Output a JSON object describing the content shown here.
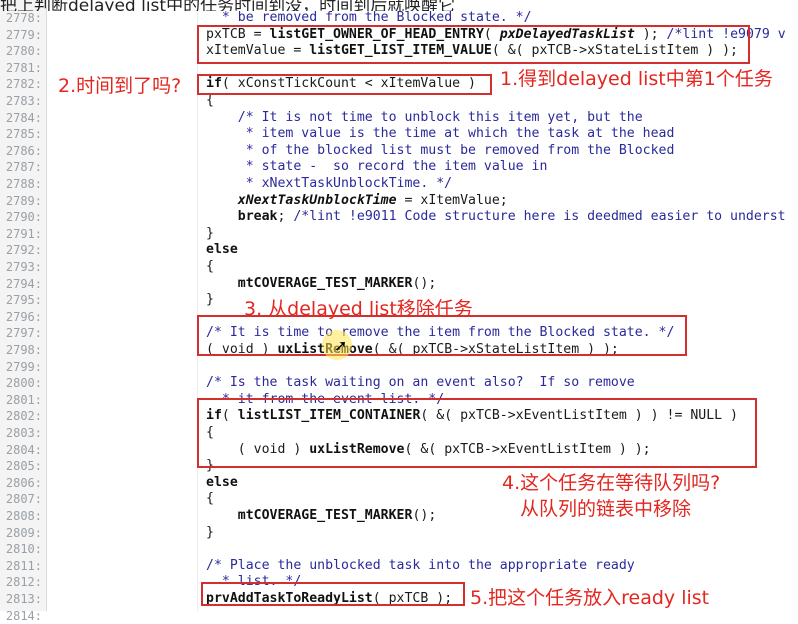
{
  "header": {
    "top_text": "把上判断delayed list中的任务时间到没，时间到后就唤醒它"
  },
  "lines": [
    {
      "num": "2778:",
      "html": "  <span class=\"cm\">* be removed from the Blocked state. */</span>"
    },
    {
      "num": "2779:",
      "html": "pxTCB = <span class=\"kw\">listGET_OWNER_OF_HEAD_ENTRY</span>( <span class=\"kw\"><i>pxDelayedTaskList</i></span> ); <span class=\"cm\">/*lint !e9079 v</span>"
    },
    {
      "num": "2780:",
      "html": "xItemValue = <span class=\"kw\">listGET_LIST_ITEM_VALUE</span>( &amp;( pxTCB-&gt;xStateListItem ) );"
    },
    {
      "num": "2781:",
      "html": ""
    },
    {
      "num": "2782:",
      "html": "<span class=\"kw\">if</span>( xConstTickCount &lt; xItemValue )"
    },
    {
      "num": "2783:",
      "html": "{"
    },
    {
      "num": "2784:",
      "html": "    <span class=\"cm\">/* It is not time to unblock this item yet, but the</span>"
    },
    {
      "num": "2785:",
      "html": "<span class=\"cm\">     * item value is the time at which the task at the head</span>"
    },
    {
      "num": "2786:",
      "html": "<span class=\"cm\">     * of the blocked list must be removed from the Blocked</span>"
    },
    {
      "num": "2787:",
      "html": "<span class=\"cm\">     * state -  so record the item value in</span>"
    },
    {
      "num": "2788:",
      "html": "<span class=\"cm\">     * xNextTaskUnblockTime. */</span>"
    },
    {
      "num": "2789:",
      "html": "    <span class=\"kw\"><i>xNextTaskUnblockTime</i></span> = xItemValue;"
    },
    {
      "num": "2790:",
      "html": "    <span class=\"kw\">break</span>; <span class=\"cm\">/*lint !e9011 Code structure here is deedmed easier to underst</span>"
    },
    {
      "num": "2791:",
      "html": "}"
    },
    {
      "num": "2792:",
      "html": "<span class=\"kw\">else</span>"
    },
    {
      "num": "2793:",
      "html": "{"
    },
    {
      "num": "2794:",
      "html": "    <span class=\"kw\">mtCOVERAGE_TEST_MARKER</span>();"
    },
    {
      "num": "2795:",
      "html": "}"
    },
    {
      "num": "2796:",
      "html": ""
    },
    {
      "num": "2797:",
      "html": "<span class=\"cm\">/* It is time to remove the item from the Blocked state. */</span>"
    },
    {
      "num": "2798:",
      "html": "( void ) <span class=\"kw\">uxListRemove</span>( &amp;( pxTCB-&gt;xStateListItem ) );"
    },
    {
      "num": "2799:",
      "html": ""
    },
    {
      "num": "2800:",
      "html": "<span class=\"cm\">/* Is the task waiting on an event also?  If so remove</span>"
    },
    {
      "num": "2801:",
      "html": "<span class=\"cm\">  * it from the event list. */</span>"
    },
    {
      "num": "2802:",
      "html": "<span class=\"kw\">if</span>( <span class=\"kw\">listLIST_ITEM_CONTAINER</span>( &amp;( pxTCB-&gt;xEventListItem ) ) != NULL )"
    },
    {
      "num": "2803:",
      "html": "{"
    },
    {
      "num": "2804:",
      "html": "    ( void ) <span class=\"kw\">uxListRemove</span>( &amp;( pxTCB-&gt;xEventListItem ) );"
    },
    {
      "num": "2805:",
      "html": "}"
    },
    {
      "num": "2806:",
      "html": "<span class=\"kw\">else</span>"
    },
    {
      "num": "2807:",
      "html": "{"
    },
    {
      "num": "2808:",
      "html": "    <span class=\"kw\">mtCOVERAGE_TEST_MARKER</span>();"
    },
    {
      "num": "2809:",
      "html": "}"
    },
    {
      "num": "2810:",
      "html": ""
    },
    {
      "num": "2811:",
      "html": "<span class=\"cm\">/* Place the unblocked task into the appropriate ready</span>"
    },
    {
      "num": "2812:",
      "html": "<span class=\"cm\">  * list. */</span>"
    },
    {
      "num": "2813:",
      "html": "<span class=\"kw\">prvAddTaskToReadyList</span>( pxTCB );"
    },
    {
      "num": "2814:",
      "html": ""
    }
  ],
  "annotations": {
    "a1": "1.得到delayed list中第1个任务",
    "a2": "2.时间到了吗?",
    "a3": "3. 从delayed list移除任务",
    "a4_line1": "4.这个任务在等待队列吗?",
    "a4_line2": "从队列的链表中移除",
    "a5": "5.把这个任务放入ready list"
  },
  "colors": {
    "annotation": "#e3261f",
    "box": "#d32f2f",
    "comment": "#2a2a9a"
  }
}
